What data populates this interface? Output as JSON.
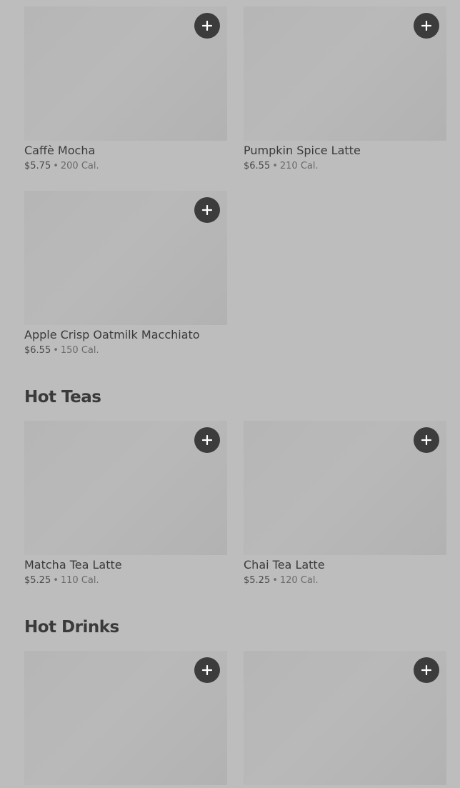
{
  "sections": [
    {
      "title": "",
      "items": [
        {
          "name": "Caffè Mocha",
          "price": "$5.75",
          "calories": "200 Cal."
        },
        {
          "name": "Pumpkin Spice Latte",
          "price": "$6.55",
          "calories": "210 Cal."
        },
        {
          "name": "Apple Crisp Oatmilk Macchiato",
          "price": "$6.55",
          "calories": "150 Cal."
        }
      ]
    },
    {
      "title": "Hot Teas",
      "items": [
        {
          "name": "Matcha Tea Latte",
          "price": "$5.25",
          "calories": "110 Cal."
        },
        {
          "name": "Chai Tea Latte",
          "price": "$5.25",
          "calories": "120 Cal."
        }
      ]
    },
    {
      "title": "Hot Drinks",
      "items": [
        {
          "name": "",
          "price": "",
          "calories": ""
        },
        {
          "name": "",
          "price": "",
          "calories": ""
        }
      ]
    }
  ],
  "separator": "•",
  "icons": {
    "add": "plus-icon"
  },
  "colors": {
    "background": "#bdbdbd",
    "thumbnail": "#b6b6b6",
    "add_button": "#3c3c3c",
    "text": "#3a3a3a"
  }
}
